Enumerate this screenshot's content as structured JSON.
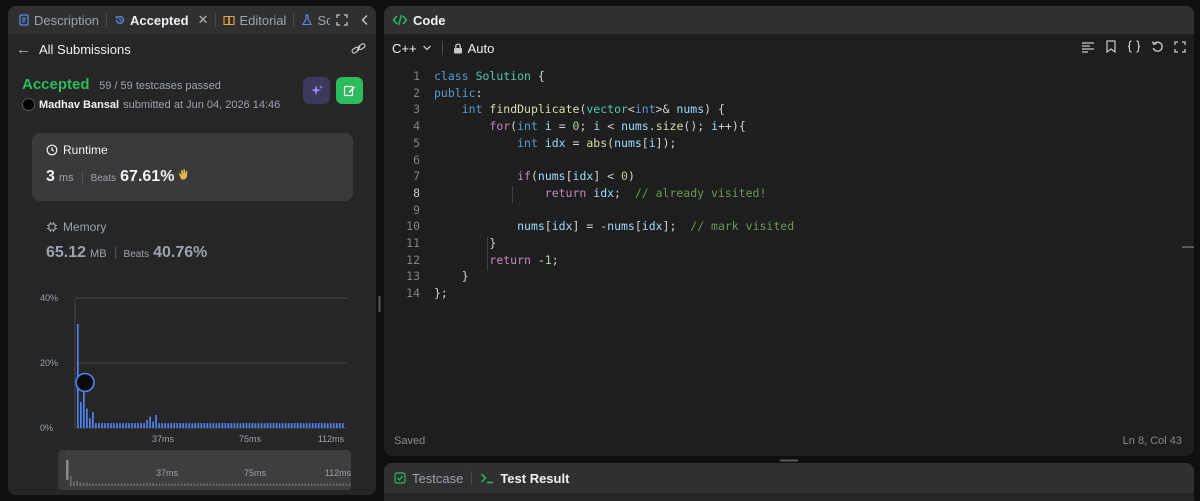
{
  "left_tabs": {
    "description": "Description",
    "accepted": "Accepted",
    "editorial": "Editorial",
    "solutions": "So"
  },
  "submissions_nav": {
    "all_submissions": "All Submissions"
  },
  "result": {
    "status": "Accepted",
    "testcases": "59 / 59 testcases passed",
    "author": "Madhav Bansal",
    "submitted_text": "submitted at Jun 04, 2026 14:46"
  },
  "runtime": {
    "label": "Runtime",
    "value": "3",
    "unit": "ms",
    "beats_label": "Beats",
    "beats_value": "67.61%"
  },
  "memory": {
    "label": "Memory",
    "value": "65.12",
    "unit": "MB",
    "beats_label": "Beats",
    "beats_value": "40.76%"
  },
  "chart_data": {
    "type": "bar",
    "title": "",
    "y_ticks": [
      "40%",
      "20%",
      "0%"
    ],
    "ylim": [
      0,
      40
    ],
    "x_ticks": [
      "37ms",
      "75ms",
      "112ms"
    ],
    "values": [
      32,
      8,
      11,
      6,
      3,
      5,
      1.5,
      1.5,
      1.5,
      1.5,
      1.5,
      1.5,
      1.5,
      1.5,
      1.5,
      1.5,
      1.5,
      1.5,
      1.5,
      1.5,
      1.5,
      1.5,
      1.5,
      2.5,
      3.5,
      2,
      4,
      1.5,
      1.5,
      1.5,
      1.5,
      1.5,
      1.5,
      1.5,
      1.5,
      1.5,
      1.5,
      1.5,
      1.5,
      1.5,
      1.5,
      1.5,
      1.5,
      1.5,
      1.5,
      1.5,
      1.5,
      1.5,
      1.5,
      1.5,
      1.5,
      1.5,
      1.5,
      1.5,
      1.5,
      1.5,
      1.5,
      1.5,
      1.5,
      1.5,
      1.5,
      1.5,
      1.5,
      1.5,
      1.5,
      1.5,
      1.5,
      1.5,
      1.5,
      1.5,
      1.5,
      1.5,
      1.5,
      1.5,
      1.5,
      1.5,
      1.5,
      1.5,
      1.5,
      1.5,
      1.5,
      1.5,
      1.5,
      1.5,
      1.5,
      1.5,
      1.5,
      1.5,
      1.5
    ],
    "highlight_index": 2,
    "highlight_value": 14,
    "bar_color": "#4f86f7",
    "mini_x_ticks": [
      "37ms",
      "75ms",
      "112ms"
    ]
  },
  "code_panel": {
    "title": "Code",
    "language": "C++",
    "mode": "Auto",
    "status": "Saved",
    "cursor": "Ln 8, Col 43",
    "current_line": 8
  },
  "code_lines": [
    "class Solution {",
    "public:",
    "    int findDuplicate(vector<int>& nums) {",
    "        for(int i = 0; i < nums.size(); i++){",
    "            int idx = abs(nums[i]);",
    "",
    "            if(nums[idx] < 0)",
    "                return idx;  // already visited!",
    "",
    "            nums[idx] = -nums[idx];  // mark visited",
    "        }",
    "        return -1;",
    "    }",
    "};"
  ],
  "bottom_tabs": {
    "testcase": "Testcase",
    "test_result": "Test Result"
  },
  "colors": {
    "accepted": "#2cbb5d",
    "accent_blue": "#4f86f7"
  }
}
